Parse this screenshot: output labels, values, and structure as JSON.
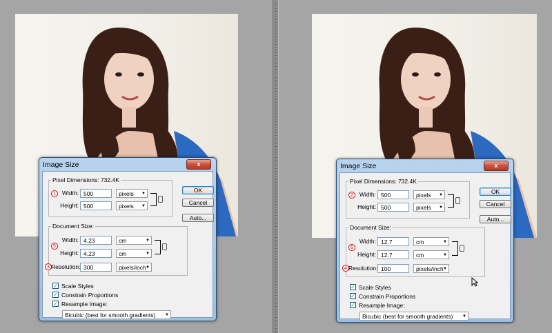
{
  "dialogs": [
    {
      "title": "Image Size",
      "close_label": "x",
      "pixel_dimensions_label": "Pixel Dimensions:",
      "pixel_dimensions_value": "732.4K",
      "pixel_width_label": "Width:",
      "pixel_width_value": "500",
      "pixel_width_unit": "pixels",
      "pixel_height_label": "Height:",
      "pixel_height_value": "500",
      "pixel_height_unit": "pixels",
      "document_size_label": "Document Size:",
      "doc_width_label": "Width:",
      "doc_width_value": "4.23",
      "doc_width_unit": "cm",
      "doc_height_label": "Height:",
      "doc_height_value": "4.23",
      "doc_height_unit": "cm",
      "resolution_label": "Resolution:",
      "resolution_value": "300",
      "resolution_unit": "pixels/inch",
      "ok_label": "OK",
      "cancel_label": "Cancel",
      "auto_label": "Auto...",
      "scale_styles_label": "Scale Styles",
      "constrain_label": "Constrain Proportions",
      "resample_label": "Resample Image:",
      "resample_method": "Bicubic (best for smooth gradients)",
      "badges": [
        "1",
        "5",
        "3"
      ]
    },
    {
      "title": "Image Size",
      "close_label": "x",
      "pixel_dimensions_label": "Pixel Dimensions:",
      "pixel_dimensions_value": "732.4K",
      "pixel_width_label": "Width:",
      "pixel_width_value": "500",
      "pixel_width_unit": "pixels",
      "pixel_height_label": "Height:",
      "pixel_height_value": "500",
      "pixel_height_unit": "pixels",
      "document_size_label": "Document Size:",
      "doc_width_label": "Width:",
      "doc_width_value": "12.7",
      "doc_width_unit": "cm",
      "doc_height_label": "Height:",
      "doc_height_value": "12.7",
      "doc_height_unit": "cm",
      "resolution_label": "Resolution:",
      "resolution_value": "100",
      "resolution_unit": "pixels/inch",
      "ok_label": "OK",
      "cancel_label": "Cancel",
      "auto_label": "Auto...",
      "scale_styles_label": "Scale Styles",
      "constrain_label": "Constrain Proportions",
      "resample_label": "Resample Image:",
      "resample_method": "Bicubic (best for smooth gradients)",
      "badges": [
        "2",
        "6",
        "4"
      ]
    }
  ],
  "checkbox_states": {
    "scale_styles": true,
    "constrain_proportions": true,
    "resample_image": true
  },
  "icons": [
    "close-icon",
    "chain-link-icon",
    "dropdown-arrow-icon",
    "mouse-cursor-icon"
  ],
  "colors": {
    "workspace": "#a5a5a5",
    "dialog_frame": "#b9d3ee",
    "close_button": "#c9513a",
    "badge": "#cc0000"
  }
}
